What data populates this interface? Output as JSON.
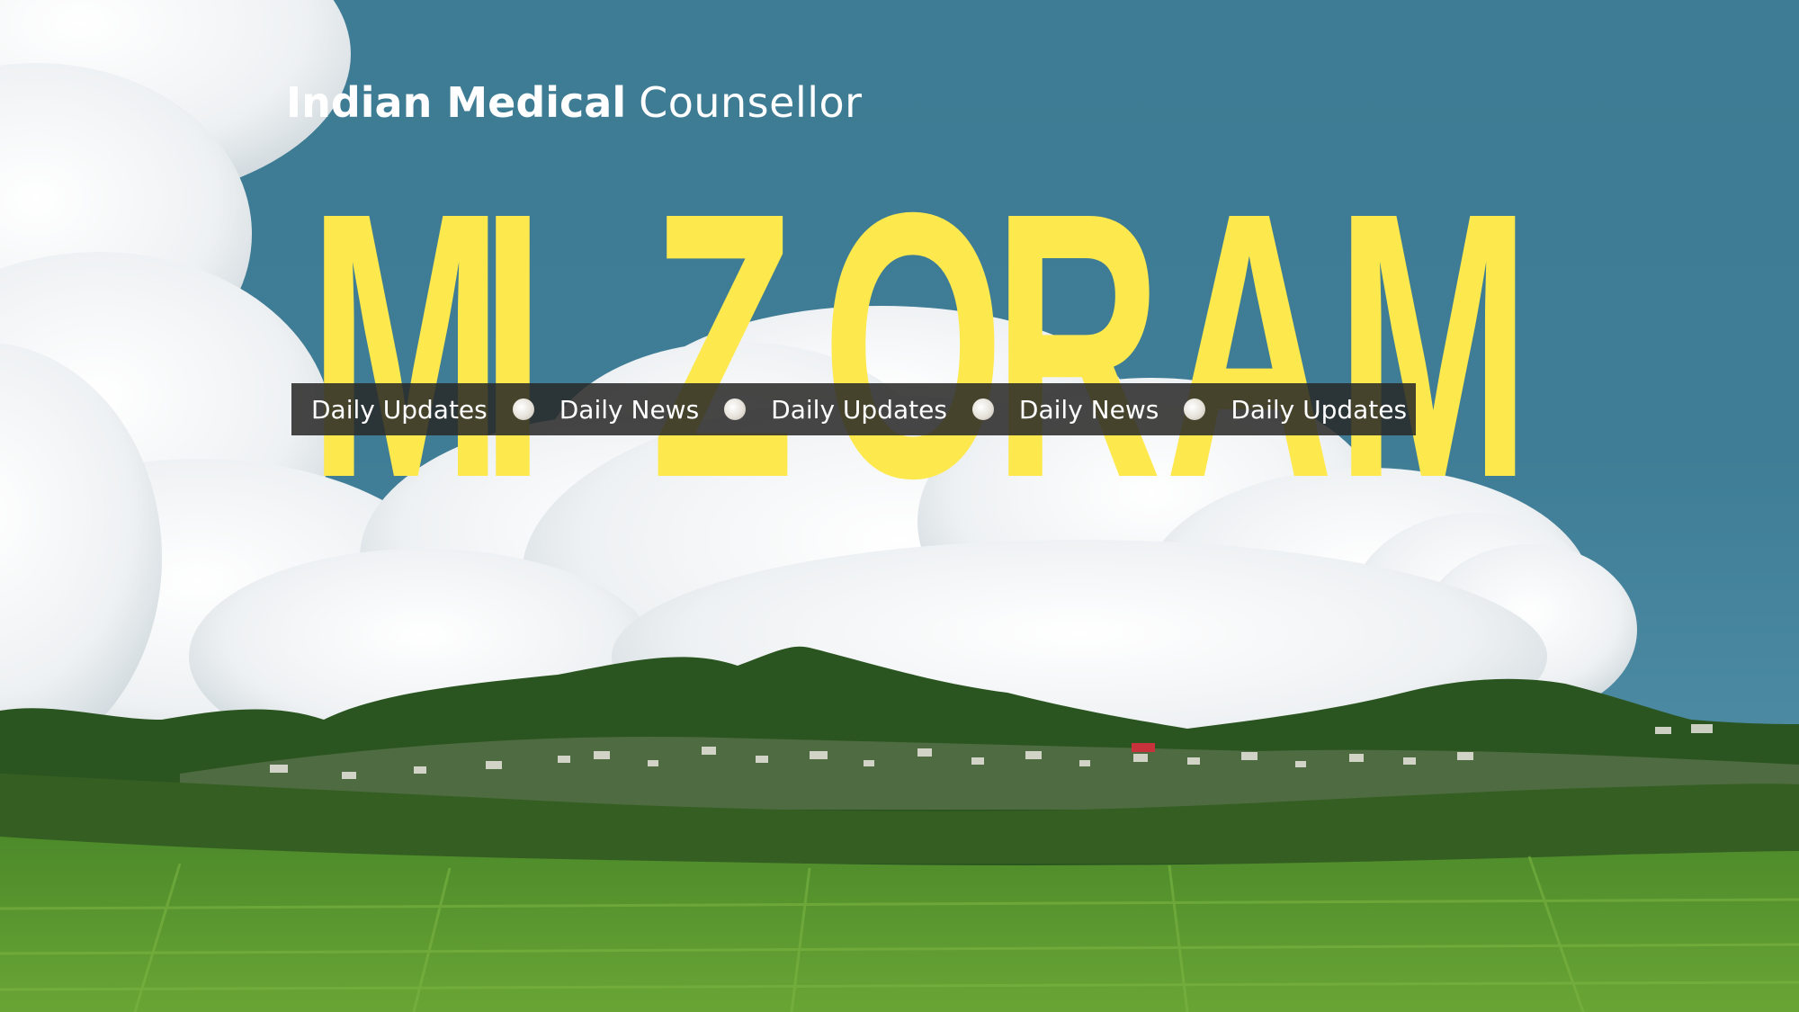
{
  "brand": {
    "bold": "Indian Medical",
    "light": "Counsellor"
  },
  "headline": {
    "letters": [
      "M",
      "I",
      "Z",
      "O",
      "R",
      "A",
      "M"
    ]
  },
  "ticker": {
    "items": [
      "Daily Updates",
      "Daily News",
      "Daily Updates",
      "Daily News",
      "Daily Updates"
    ]
  },
  "colors": {
    "sky": "#3e7b94",
    "headline": "#fde84e",
    "ticker_bg": "#282826",
    "hills": "#2b5520",
    "fields": "#5f9c2f"
  }
}
